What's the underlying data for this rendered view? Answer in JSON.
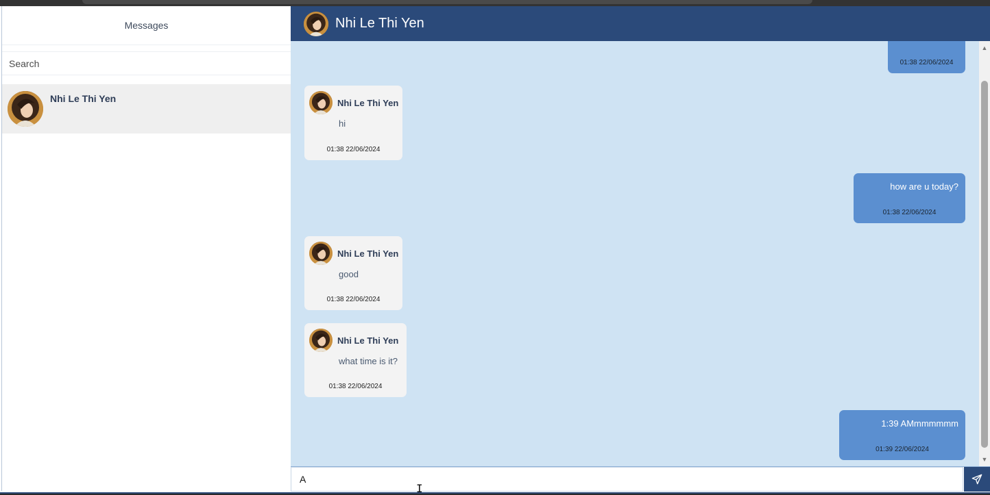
{
  "sidebar": {
    "title": "Messages",
    "search_placeholder": "Search",
    "contacts": [
      {
        "name": "Nhi Le Thi Yen"
      }
    ]
  },
  "chat": {
    "header_name": "Nhi Le Thi Yen",
    "messages": [
      {
        "direction": "out",
        "text": "",
        "time": "01:38 22/06/2024"
      },
      {
        "direction": "in",
        "sender": "Nhi Le Thi Yen",
        "text": "hi",
        "time": "01:38 22/06/2024"
      },
      {
        "direction": "out",
        "text": "how are u today?",
        "time": "01:38 22/06/2024"
      },
      {
        "direction": "in",
        "sender": "Nhi Le Thi Yen",
        "text": "good",
        "time": "01:38 22/06/2024"
      },
      {
        "direction": "in",
        "sender": "Nhi Le Thi Yen",
        "text": "what time is it?",
        "time": "01:38 22/06/2024"
      },
      {
        "direction": "out",
        "text": "1:39 AMmmmmmm",
        "time": "01:39 22/06/2024"
      }
    ],
    "composer_value": "A"
  },
  "icons": {
    "send": "send-icon",
    "scroll_up": "chevron-up-icon",
    "scroll_down": "chevron-down-icon"
  },
  "colors": {
    "header": "#2b4a7a",
    "chat_bg": "#cfe3f3",
    "outgoing_bubble": "#5b8fd0",
    "incoming_bubble": "#f3f3f3"
  }
}
